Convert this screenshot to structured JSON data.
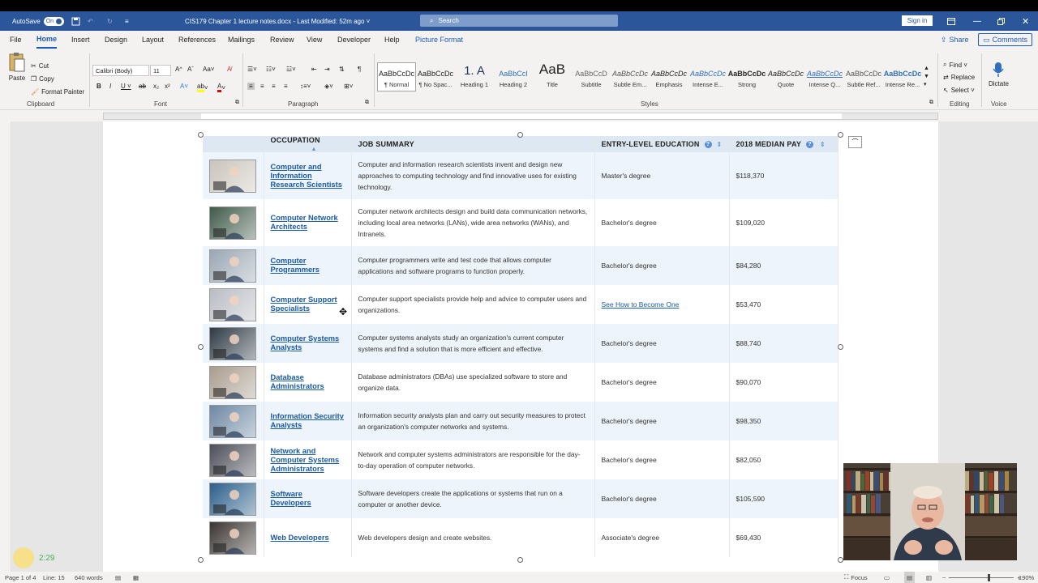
{
  "titlebar": {
    "autosave_label": "AutoSave",
    "autosave_state": "On",
    "doc_title": "CIS179 Chapter 1 lecture notes.docx  -  Last Modified: 52m ago  ˅",
    "search_placeholder": "Search",
    "signin": "Sign in"
  },
  "tabs": [
    {
      "label": "File"
    },
    {
      "label": "Home"
    },
    {
      "label": "Insert"
    },
    {
      "label": "Design"
    },
    {
      "label": "Layout"
    },
    {
      "label": "References"
    },
    {
      "label": "Mailings"
    },
    {
      "label": "Review"
    },
    {
      "label": "View"
    },
    {
      "label": "Developer"
    },
    {
      "label": "Help"
    },
    {
      "label": "Picture Format"
    }
  ],
  "share": "Share",
  "comments": "Comments",
  "ribbon": {
    "clipboard": {
      "paste": "Paste",
      "cut": "Cut",
      "copy": "Copy",
      "format_painter": "Format Painter",
      "label": "Clipboard"
    },
    "font": {
      "name": "Calibri (Body)",
      "size": "11",
      "label": "Font"
    },
    "paragraph": {
      "label": "Paragraph"
    },
    "styles": {
      "label": "Styles",
      "items": [
        {
          "sample": "AaBbCcDc",
          "name": "¶ Normal"
        },
        {
          "sample": "AaBbCcDc",
          "name": "¶ No Spac..."
        },
        {
          "sample": "1. A",
          "name": "Heading 1"
        },
        {
          "sample": "AaBbCcI",
          "name": "Heading 2"
        },
        {
          "sample": "AaB",
          "name": "Title"
        },
        {
          "sample": "AaBbCcD",
          "name": "Subtitle"
        },
        {
          "sample": "AaBbCcDc",
          "name": "Subtle Em..."
        },
        {
          "sample": "AaBbCcDc",
          "name": "Emphasis"
        },
        {
          "sample": "AaBbCcDc",
          "name": "Intense E..."
        },
        {
          "sample": "AaBbCcDc",
          "name": "Strong"
        },
        {
          "sample": "AaBbCcDc",
          "name": "Quote"
        },
        {
          "sample": "AaBbCcDc",
          "name": "Intense Q..."
        },
        {
          "sample": "AaBbCcDc",
          "name": "Subtle Ref..."
        },
        {
          "sample": "AaBbCcDc",
          "name": "Intense Re..."
        }
      ]
    },
    "editing": {
      "find": "Find",
      "replace": "Replace",
      "select": "Select",
      "label": "Editing"
    },
    "voice": {
      "dictate": "Dictate",
      "label": "Voice"
    }
  },
  "table": {
    "headers": {
      "occupation": "OCCUPATION",
      "summary": "JOB SUMMARY",
      "education": "ENTRY-LEVEL EDUCATION",
      "pay": "2018 MEDIAN PAY"
    },
    "rows": [
      {
        "occupation": "Computer and Information Research Scientists",
        "summary": "Computer and information research scientists invent and design new approaches to computing technology and find innovative uses for existing technology.",
        "education": "Master's degree",
        "pay": "$118,370",
        "thumb_color": "#c9c4bb"
      },
      {
        "occupation": "Computer Network Architects",
        "summary": "Computer network architects design and build data communication networks, including local area networks (LANs), wide area networks (WANs), and Intranets.",
        "education": "Bachelor's degree",
        "pay": "$109,020",
        "thumb_color": "#3f5a4a"
      },
      {
        "occupation": "Computer Programmers",
        "summary": "Computer programmers write and test code that allows computer applications and software programs to function properly.",
        "education": "Bachelor's degree",
        "pay": "$84,280",
        "thumb_color": "#9aa6b3"
      },
      {
        "occupation": "Computer Support Specialists",
        "summary": "Computer support specialists provide help and advice to computer users and organizations.",
        "education": "See How to Become One",
        "pay": "$53,470",
        "thumb_color": "#b9bcc4"
      },
      {
        "occupation": "Computer Systems Analysts",
        "summary": "Computer systems analysts study an organization's current computer systems and find a solution that is more efficient and effective.",
        "education": "Bachelor's degree",
        "pay": "$88,740",
        "thumb_color": "#2e3a44"
      },
      {
        "occupation": "Database Administrators",
        "summary": "Database administrators (DBAs) use specialized software to store and organize data.",
        "education": "Bachelor's degree",
        "pay": "$90,070",
        "thumb_color": "#a89d8e"
      },
      {
        "occupation": "Information Security Analysts",
        "summary": "Information security analysts plan and carry out security measures to protect an organization's computer networks and systems.",
        "education": "Bachelor's degree",
        "pay": "$98,350",
        "thumb_color": "#6d88a3"
      },
      {
        "occupation": "Network and Computer Systems Administrators",
        "summary": "Network and computer systems administrators are responsible for the day-to-day operation of computer networks.",
        "education": "Bachelor's degree",
        "pay": "$82,050",
        "thumb_color": "#4b4d58"
      },
      {
        "occupation": "Software Developers",
        "summary": "Software developers create the applications or systems that run on a computer or another device.",
        "education": "Bachelor's degree",
        "pay": "$105,590",
        "thumb_color": "#2b5f8a"
      },
      {
        "occupation": "Web Developers",
        "summary": "Web developers design and create websites.",
        "education": "Associate's degree",
        "pay": "$69,430",
        "thumb_color": "#3a3431"
      }
    ]
  },
  "status": {
    "page": "Page 1 of 4",
    "line": "Line: 15",
    "words": "640 words",
    "focus": "Focus",
    "zoom": "190%"
  },
  "timer": "2:29"
}
